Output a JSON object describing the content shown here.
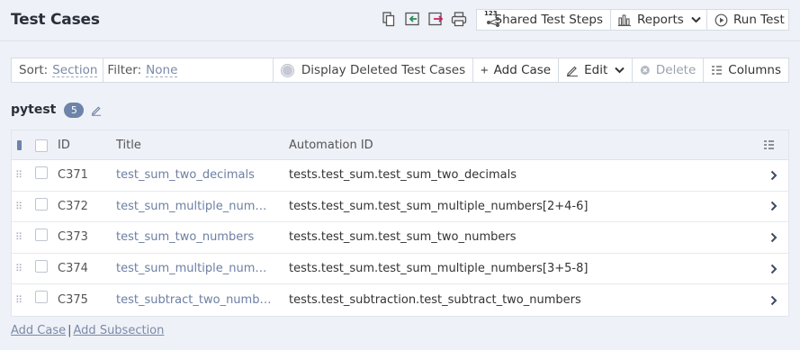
{
  "header": {
    "title": "Test Cases",
    "icons": [
      "copy-icon",
      "import-icon",
      "export-icon",
      "print-icon"
    ],
    "shared_steps_label": "Shared Test Steps",
    "shared_steps_badge": "123",
    "reports_label": "Reports",
    "run_test_label": "Run Test"
  },
  "toolbar": {
    "sort_label": "Sort:",
    "sort_value": "Section",
    "filter_label": "Filter:",
    "filter_value": "None",
    "deleted_toggle_label": "Display Deleted Test Cases",
    "add_case_label": "Add Case",
    "edit_label": "Edit",
    "delete_label": "Delete",
    "columns_label": "Columns"
  },
  "section": {
    "name": "pytest",
    "count": "5"
  },
  "table": {
    "columns": [
      "ID",
      "Title",
      "Automation ID"
    ],
    "rows": [
      {
        "id": "C371",
        "title": "test_sum_two_decimals",
        "automation_id": "tests.test_sum.test_sum_two_decimals"
      },
      {
        "id": "C372",
        "title": "test_sum_multiple_numbe...",
        "automation_id": "tests.test_sum.test_sum_multiple_numbers[2+4-6]"
      },
      {
        "id": "C373",
        "title": "test_sum_two_numbers",
        "automation_id": "tests.test_sum.test_sum_two_numbers"
      },
      {
        "id": "C374",
        "title": "test_sum_multiple_numbe...",
        "automation_id": "tests.test_sum.test_sum_multiple_numbers[3+5-8]"
      },
      {
        "id": "C375",
        "title": "test_subtract_two_numbers",
        "automation_id": "tests.test_subtraction.test_subtract_two_numbers"
      }
    ]
  },
  "footer": {
    "add_case_label": "Add Case",
    "separator": "|",
    "add_subsection_label": "Add Subsection"
  },
  "colors": {
    "background": "#eef1f7",
    "link": "#6d7fa3",
    "badge": "#6d83a9",
    "import_icon": "#2e8b57",
    "export_icon": "#c0245c"
  }
}
